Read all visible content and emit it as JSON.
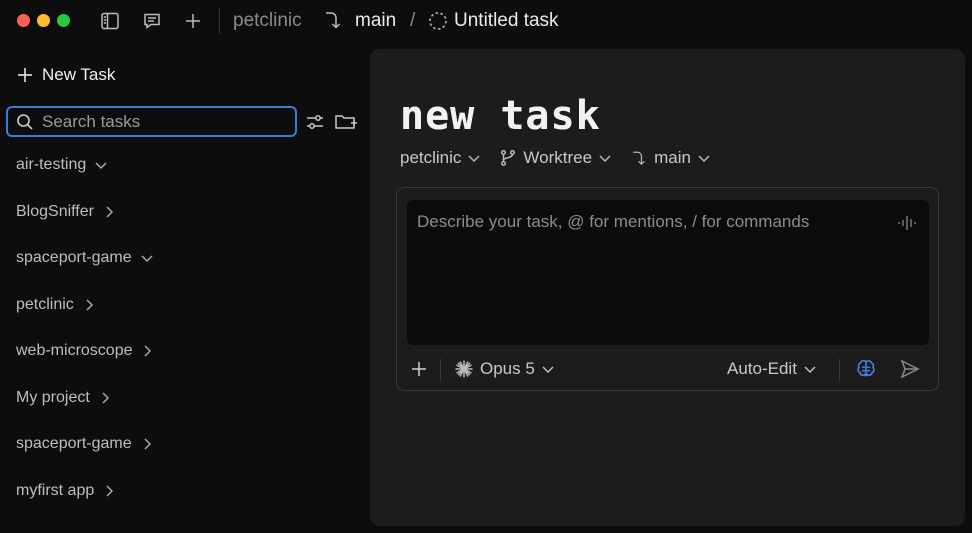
{
  "titlebar": {
    "breadcrumb_repo": "petclinic",
    "breadcrumb_branch": "main",
    "breadcrumb_sep": "/",
    "breadcrumb_task": "Untitled task"
  },
  "sidebar": {
    "new_task_label": "New Task",
    "search_placeholder": "Search tasks",
    "projects": [
      {
        "label": "air-testing",
        "expanded": true
      },
      {
        "label": "BlogSniffer",
        "expanded": false
      },
      {
        "label": "spaceport-game",
        "expanded": true
      },
      {
        "label": "petclinic",
        "expanded": false
      },
      {
        "label": "web-microscope",
        "expanded": false
      },
      {
        "label": "My project",
        "expanded": false
      },
      {
        "label": "spaceport-game",
        "expanded": false
      },
      {
        "label": "myfirst app",
        "expanded": false
      }
    ]
  },
  "main": {
    "title": "new task",
    "repo_selector": "petclinic",
    "mode_selector": "Worktree",
    "branch_selector": "main",
    "prompt_placeholder": "Describe your task, @ for mentions, / for commands",
    "model_label": "Opus 5",
    "edit_mode_label": "Auto-Edit"
  },
  "colors": {
    "accent_focus": "#3f7ad6",
    "brain_icon": "#4a86e8",
    "traffic_red": "#fe5f57",
    "traffic_yellow": "#febc2e",
    "traffic_green": "#28c840"
  }
}
